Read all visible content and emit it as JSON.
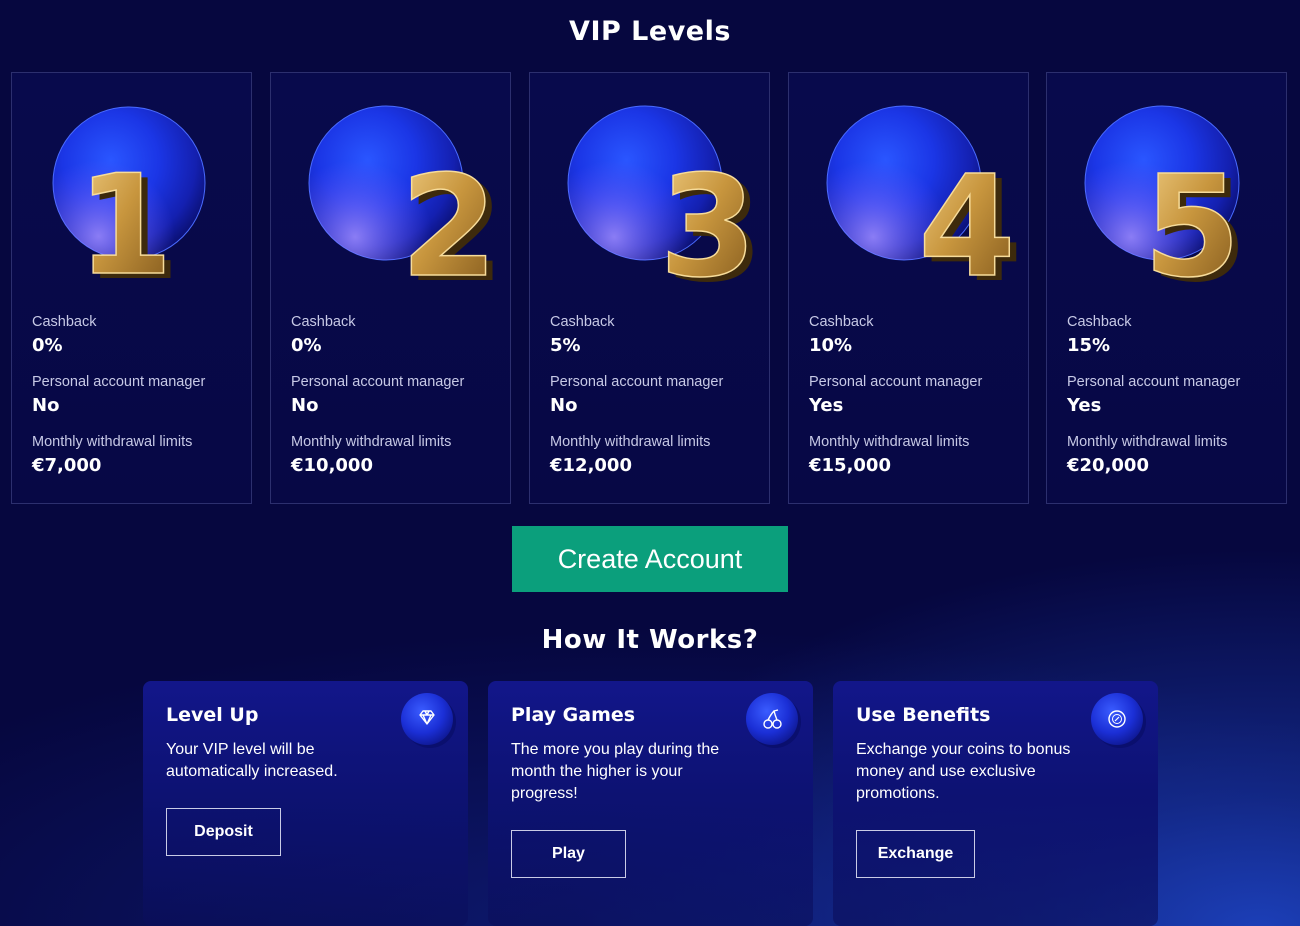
{
  "vip_section": {
    "title": "VIP Levels"
  },
  "levels": [
    {
      "number": "1",
      "cashback_label": "Cashback",
      "cashback": "0%",
      "manager_label": "Personal account manager",
      "manager": "No",
      "limits_label": "Monthly withdrawal limits",
      "limits": "€7,000"
    },
    {
      "number": "2",
      "cashback_label": "Cashback",
      "cashback": "0%",
      "manager_label": "Personal account manager",
      "manager": "No",
      "limits_label": "Monthly withdrawal limits",
      "limits": "€10,000"
    },
    {
      "number": "3",
      "cashback_label": "Cashback",
      "cashback": "5%",
      "manager_label": "Personal account manager",
      "manager": "No",
      "limits_label": "Monthly withdrawal limits",
      "limits": "€12,000"
    },
    {
      "number": "4",
      "cashback_label": "Cashback",
      "cashback": "10%",
      "manager_label": "Personal account manager",
      "manager": "Yes",
      "limits_label": "Monthly withdrawal limits",
      "limits": "€15,000"
    },
    {
      "number": "5",
      "cashback_label": "Cashback",
      "cashback": "15%",
      "manager_label": "Personal account manager",
      "manager": "Yes",
      "limits_label": "Monthly withdrawal limits",
      "limits": "€20,000"
    }
  ],
  "cta": {
    "label": "Create Account"
  },
  "how_section": {
    "title": "How It Works?"
  },
  "steps": [
    {
      "title": "Level Up",
      "text": "Your VIP level will be automatically increased.",
      "button": "Deposit",
      "icon": "diamond-icon"
    },
    {
      "title": "Play Games",
      "text": "The more you play during the month the higher is your progress!",
      "button": "Play",
      "icon": "cherries-icon"
    },
    {
      "title": "Use Benefits",
      "text": "Exchange your coins to bonus money and use exclusive promotions.",
      "button": "Exchange",
      "icon": "coin-exchange-icon"
    }
  ],
  "colors": {
    "background": "#06073f",
    "card_border": "#2c2f6e",
    "cta": "#0b9f7c",
    "gold": "#c8963e",
    "sphere": "#1f3df0"
  }
}
